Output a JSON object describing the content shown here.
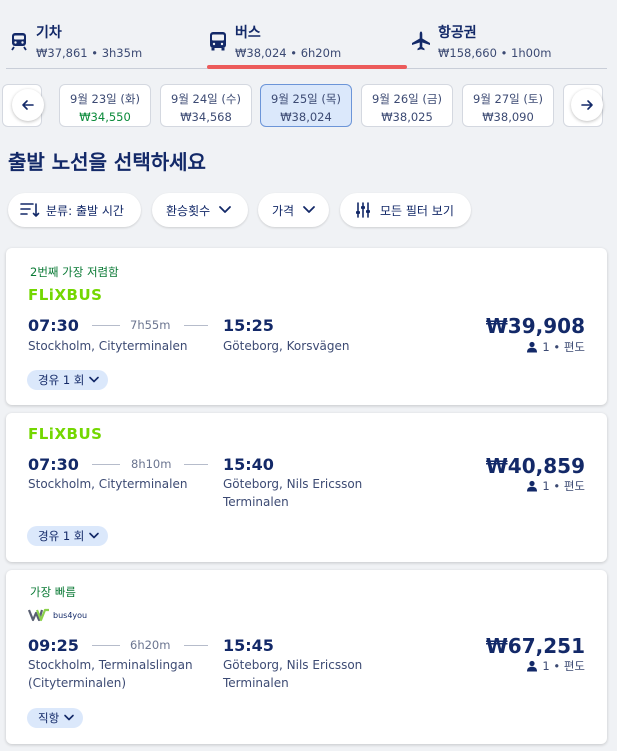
{
  "modes": [
    {
      "title": "기차",
      "sub": "₩37,861 • 3h35m",
      "icon": "train-icon"
    },
    {
      "title": "버스",
      "sub": "₩38,024 • 6h20m",
      "icon": "bus-icon"
    },
    {
      "title": "항공권",
      "sub": "₩158,660 • 1h00m",
      "icon": "plane-icon"
    }
  ],
  "dates": [
    {
      "date": "9월 23일 (화)",
      "price": "₩34,550"
    },
    {
      "date": "9월 24일 (수)",
      "price": "₩34,568"
    },
    {
      "date": "9월 25일 (목)",
      "price": "₩38,024"
    },
    {
      "date": "9월 26일 (금)",
      "price": "₩38,025"
    },
    {
      "date": "9월 27일 (토)",
      "price": "₩38,090"
    }
  ],
  "page_title": "출발 노선을 선택하세요",
  "filters": {
    "sort": "분류: 출발 시간",
    "transfers": "환승횟수",
    "price": "가격",
    "all": "모든 필터 보기"
  },
  "results": [
    {
      "tag": "2번째 가장 저렴함",
      "operator": "FLiXBUS",
      "dep_time": "07:30",
      "duration": "7h55m",
      "arr_time": "15:25",
      "dep_place": "Stockholm, Cityterminalen",
      "arr_place": "Göteborg, Korsvägen",
      "price": "₩39,908",
      "pax": "1 • 편도",
      "stops": "경유 1 회"
    },
    {
      "tag": "",
      "operator": "FLiXBUS",
      "dep_time": "07:30",
      "duration": "8h10m",
      "arr_time": "15:40",
      "dep_place": "Stockholm, Cityterminalen",
      "arr_place_1": "Göteborg, Nils Ericsson",
      "arr_place_2": "Terminalen",
      "price": "₩40,859",
      "pax": "1 • 편도",
      "stops": "경유 1 회"
    },
    {
      "tag": "가장 빠름",
      "operator": "bus4you",
      "dep_time": "09:25",
      "duration": "6h20m",
      "arr_time": "15:45",
      "dep_place_1": "Stockholm, Terminalslingan",
      "dep_place_2": "(Cityterminalen)",
      "arr_place_1": "Göteborg, Nils Ericsson",
      "arr_place_2": "Terminalen",
      "price": "₩67,251",
      "pax": "1 • 편도",
      "stops": "직항"
    }
  ]
}
